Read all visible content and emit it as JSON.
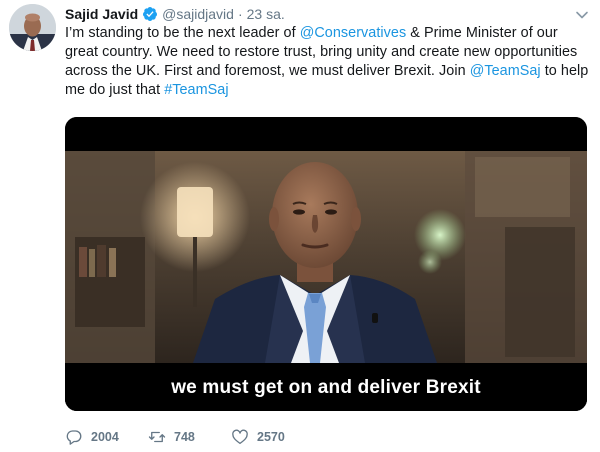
{
  "author": {
    "name": "Sajid Javid",
    "handle": "@sajidjavid",
    "separator": "·",
    "time": "23 sa."
  },
  "tweet": {
    "lines": [
      [
        {
          "text": "I’m standing to be the next leader of ",
          "link": false
        },
        {
          "text": "@Conservatives",
          "link": true
        },
        {
          "text": " & Prime Minister of our",
          "link": false
        }
      ],
      [
        {
          "text": "great country. We need to restore trust, bring unity and create new opportunities",
          "link": false
        }
      ],
      [
        {
          "text": "across the UK. First and foremost, we must deliver Brexit. Join ",
          "link": false
        },
        {
          "text": "@TeamSaj",
          "link": true
        },
        {
          "text": " to help",
          "link": false
        }
      ],
      [
        {
          "text": "me do just that ",
          "link": false
        },
        {
          "text": "#TeamSaj",
          "link": true
        }
      ]
    ]
  },
  "media": {
    "caption": "we must get on and deliver Brexit"
  },
  "actions": {
    "replies": "2004",
    "retweets": "748",
    "likes": "2570"
  },
  "colors": {
    "link": "#1b95e0",
    "verified": "#1da1f2",
    "muted": "#657786",
    "text": "#14171a"
  },
  "icons": {
    "verified": "verified-badge-icon",
    "caret": "chevron-down-icon",
    "reply": "reply-icon",
    "retweet": "retweet-icon",
    "like": "heart-icon"
  }
}
